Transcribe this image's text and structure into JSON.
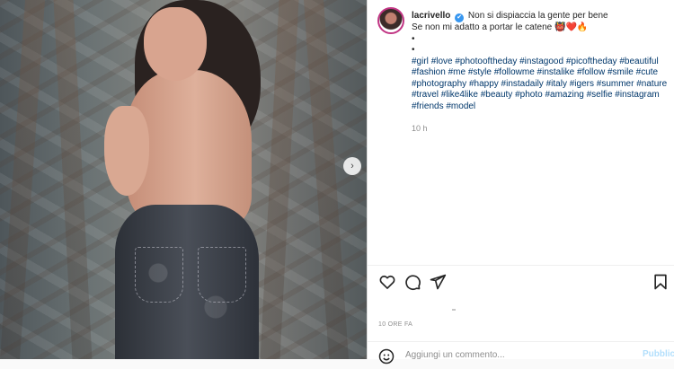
{
  "post": {
    "username": "lacrivello",
    "verified_symbol": "✔",
    "caption_lines": [
      "Non si dispiaccia la gente per bene",
      "Se non mi adatto a portar le catene 👹❤️🔥",
      "•",
      "•"
    ],
    "hashtags": [
      "#girl",
      "#love",
      "#photooftheday",
      "#instagood",
      "#picoftheday",
      "#beautiful",
      "#fashion",
      "#me",
      "#style",
      "#followme",
      "#instalike",
      "#follow",
      "#smile",
      "#cute",
      "#photography",
      "#happy",
      "#instadaily",
      "#italy",
      "#igers",
      "#summer",
      "#nature",
      "#travel",
      "#like4like",
      "#beauty",
      "#photo",
      "#amazing",
      "#selfie",
      "#instagram",
      "#friends",
      "#model"
    ],
    "time_ago": "10 h",
    "posted_ago": "10 ORE FA"
  },
  "media": {
    "next_arrow": "›"
  },
  "actions": {
    "like_icon": "heart-icon",
    "comment_icon": "comment-icon",
    "share_icon": "paper-plane-icon",
    "save_icon": "bookmark-icon"
  },
  "comment": {
    "placeholder": "Aggiungi un commento...",
    "publish_label": "Pubblica"
  },
  "colors": {
    "hashtag": "#00376b",
    "muted": "#8e8e8e",
    "publish_disabled": "#b2dffc",
    "verified": "#3897f0"
  }
}
